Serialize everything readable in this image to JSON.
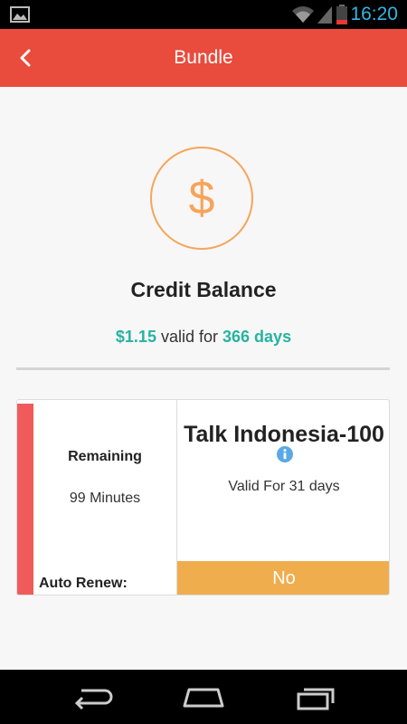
{
  "status_bar": {
    "time": "16:20",
    "icons": [
      "gallery-icon",
      "wifi-icon",
      "signal-icon",
      "battery-icon"
    ]
  },
  "app_bar": {
    "title": "Bundle",
    "back_icon": "chevron-left-icon",
    "color": "#e94b3c"
  },
  "balance": {
    "icon": "dollar-icon",
    "symbol": "$",
    "title": "Credit Balance",
    "amount": "$1.15",
    "valid_for_text": "valid for",
    "days": "366 days"
  },
  "bundle": {
    "remaining_label": "Remaining",
    "remaining_value": "99 Minutes",
    "auto_renew_label": "Auto Renew:",
    "plan_name": "Talk Indonesia-100",
    "info_icon": "info-icon",
    "validity": "Valid For 31 days",
    "auto_renew_value": "No"
  },
  "nav_bar": {
    "icons": [
      "back-nav-icon",
      "home-nav-icon",
      "recents-nav-icon"
    ]
  },
  "colors": {
    "accent": "#e94b3c",
    "teal": "#26b3a1",
    "orange": "#f7a45a",
    "toggle": "#f0ad4e",
    "stripe": "#f15a5a",
    "status_blue": "#33b5e5"
  }
}
